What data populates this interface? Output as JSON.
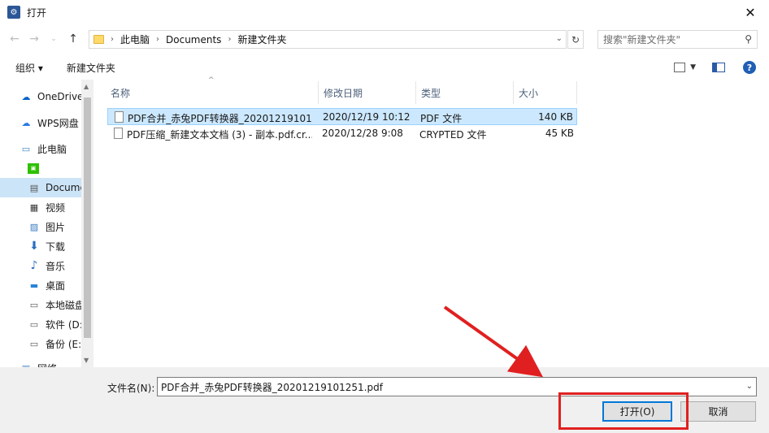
{
  "window": {
    "title": "打开",
    "close_icon": "close-icon"
  },
  "nav": {
    "breadcrumb": [
      "此电脑",
      "Documents",
      "新建文件夹"
    ],
    "search_placeholder": "搜索\"新建文件夹\""
  },
  "toolbar": {
    "organize": "组织",
    "new_folder": "新建文件夹"
  },
  "sidebar": {
    "items": [
      {
        "label": "OneDrive",
        "icon": "cloud-icon"
      },
      {
        "label": "WPS网盘",
        "icon": "wps-cloud-icon"
      },
      {
        "label": "此电脑",
        "icon": "computer-icon"
      },
      {
        "label": "",
        "icon": "wechat-files-icon"
      },
      {
        "label": "Docume",
        "icon": "document-icon"
      },
      {
        "label": "视频",
        "icon": "video-icon"
      },
      {
        "label": "图片",
        "icon": "picture-icon"
      },
      {
        "label": "下载",
        "icon": "download-icon"
      },
      {
        "label": "音乐",
        "icon": "music-icon"
      },
      {
        "label": "桌面",
        "icon": "desktop-icon"
      },
      {
        "label": "本地磁盘",
        "icon": "drive-icon"
      },
      {
        "label": "软件 (D:",
        "icon": "drive-icon"
      },
      {
        "label": "备份 (E:)",
        "icon": "drive-icon"
      },
      {
        "label": "网络",
        "icon": "network-icon"
      }
    ]
  },
  "columns": {
    "name": "名称",
    "modified": "修改日期",
    "type": "类型",
    "size": "大小"
  },
  "files": [
    {
      "name": "PDF合并_赤兔PDF转换器_20201219101...",
      "modified": "2020/12/19 10:12",
      "type": "PDF 文件",
      "size": "140 KB",
      "selected": true
    },
    {
      "name": "PDF压缩_新建文本文档 (3) - 副本.pdf.cr...",
      "modified": "2020/12/28 9:08",
      "type": "CRYPTED 文件",
      "size": "45 KB",
      "selected": false
    }
  ],
  "footer": {
    "filename_label": "文件名(N):",
    "filename_value": "PDF合并_赤兔PDF转换器_20201219101251.pdf",
    "open_label": "打开(O)",
    "cancel_label": "取消"
  },
  "colors": {
    "accent": "#0078d7",
    "annotation": "#e02020",
    "selection": "#cce8ff"
  }
}
